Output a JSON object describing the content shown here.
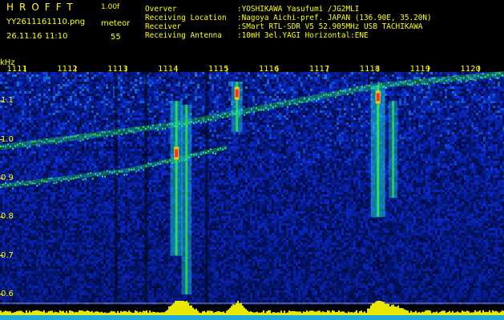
{
  "header": {
    "app_title": "HROFFT",
    "app_version": "1.00f",
    "filename": "YY2611161110.png",
    "mode": "meteor",
    "timestamp": "26.11.16 11:10",
    "count": "55",
    "info": [
      {
        "label": "Overver",
        "value": ":YOSHIKAWA Yasufumi /JG2MLI"
      },
      {
        "label": "Receiving Location",
        "value": ":Nagoya Aichi-pref. JAPAN (136.90E, 35.20N)"
      },
      {
        "label": "Receiver",
        "value": ":SMart RTL-SDR V5 52.905MHz USB TACHIKAWA"
      },
      {
        "label": "Receiving Antenna",
        "value": ":10mH 3el.YAGI Horizontal:ENE"
      }
    ]
  },
  "axes": {
    "y_unit": "kHz",
    "y_ticks": [
      "1.1",
      "1.0",
      "0.9",
      "0.8",
      "0.7",
      "0.6"
    ],
    "x_ticks": [
      "1111",
      "1112",
      "1113",
      "1114",
      "1115",
      "1116",
      "1117",
      "1118",
      "1119",
      "1120"
    ]
  },
  "colors": {
    "background": "#000000",
    "label": "#ffff00",
    "text": "#ffff00",
    "noise_low": "#000a3c",
    "noise_mid": "#0a2ad0",
    "noise_high": "#20d0e0",
    "signal": "#30f040",
    "peak": "#ff3010",
    "power_bar": "#e8e800",
    "baseline": "#20a8d8"
  },
  "spectrogram": {
    "time_range": [
      1110.5,
      1120.5
    ],
    "freq_range": [
      0.575,
      1.175
    ],
    "drift_trace": [
      [
        1110.5,
        0.98
      ],
      [
        1114,
        1.04
      ],
      [
        1116,
        1.09
      ],
      [
        1118,
        1.14
      ],
      [
        1120.5,
        1.17
      ]
    ],
    "lower_trace": [
      [
        1110.5,
        0.88
      ],
      [
        1113,
        0.92
      ],
      [
        1114,
        0.95
      ],
      [
        1115,
        0.98
      ]
    ],
    "meteors": [
      {
        "time": 1114.0,
        "fmin": 0.7,
        "fmax": 1.1,
        "strength": 0.8,
        "peak": 0.965
      },
      {
        "time": 1114.2,
        "fmin": 0.6,
        "fmax": 1.09,
        "strength": 0.6,
        "peak": null
      },
      {
        "time": 1115.2,
        "fmin": 1.02,
        "fmax": 1.15,
        "strength": 0.7,
        "peak": 1.12
      },
      {
        "time": 1118.0,
        "fmin": 0.8,
        "fmax": 1.14,
        "strength": 1.0,
        "peak": 1.11
      },
      {
        "time": 1118.3,
        "fmin": 0.85,
        "fmax": 1.1,
        "strength": 0.5,
        "peak": null
      }
    ],
    "dark_columns": [
      1112.8,
      1113.4,
      1114.6
    ]
  }
}
